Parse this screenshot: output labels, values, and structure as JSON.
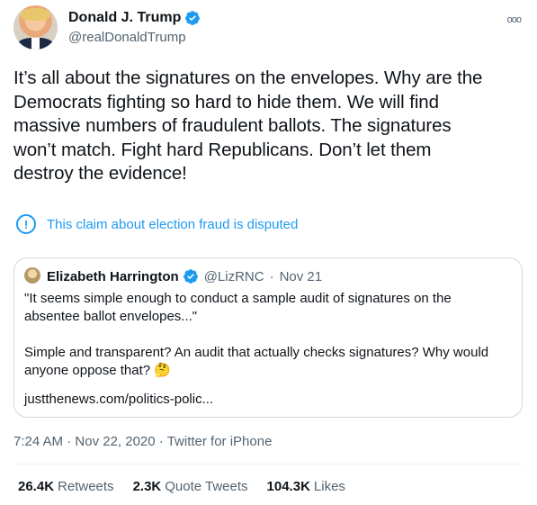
{
  "author": {
    "name": "Donald J. Trump",
    "handle": "@realDonaldTrump"
  },
  "more_label": "ooo",
  "tweet": {
    "text": "It’s all about the signatures on the envelopes. Why are the\nDemocrats fighting so hard to hide them. We will find\nmassive numbers of fraudulent ballots. The signatures\nwon’t match. Fight hard Republicans. Don’t let them\ndestroy the evidence!"
  },
  "disputed": {
    "icon": "!",
    "text": "This claim about election fraud is disputed"
  },
  "quote": {
    "name": "Elizabeth Harrington",
    "handle": "@LizRNC",
    "separator": "·",
    "date": "Nov 21",
    "body": "\"It seems simple enough to conduct a sample audit of signatures on the\nabsentee ballot envelopes...\"\n\nSimple and transparent? An audit that actually checks signatures? Why would\nanyone oppose that? 🤔",
    "link": "justthenews.com/politics-polic..."
  },
  "timestamp": {
    "time": "7:24 AM",
    "separator": "·",
    "date": "Nov 22, 2020",
    "separator2": "·",
    "source": "Twitter for iPhone"
  },
  "stats": {
    "retweets": {
      "count": "26.4K",
      "label": "Retweets"
    },
    "quote_tweets": {
      "count": "2.3K",
      "label": "Quote Tweets"
    },
    "likes": {
      "count": "104.3K",
      "label": "Likes"
    }
  },
  "colors": {
    "verified": "#1d9bf0",
    "accent": "#1d9bf0",
    "muted": "#536471",
    "border": "#cfd9de"
  }
}
